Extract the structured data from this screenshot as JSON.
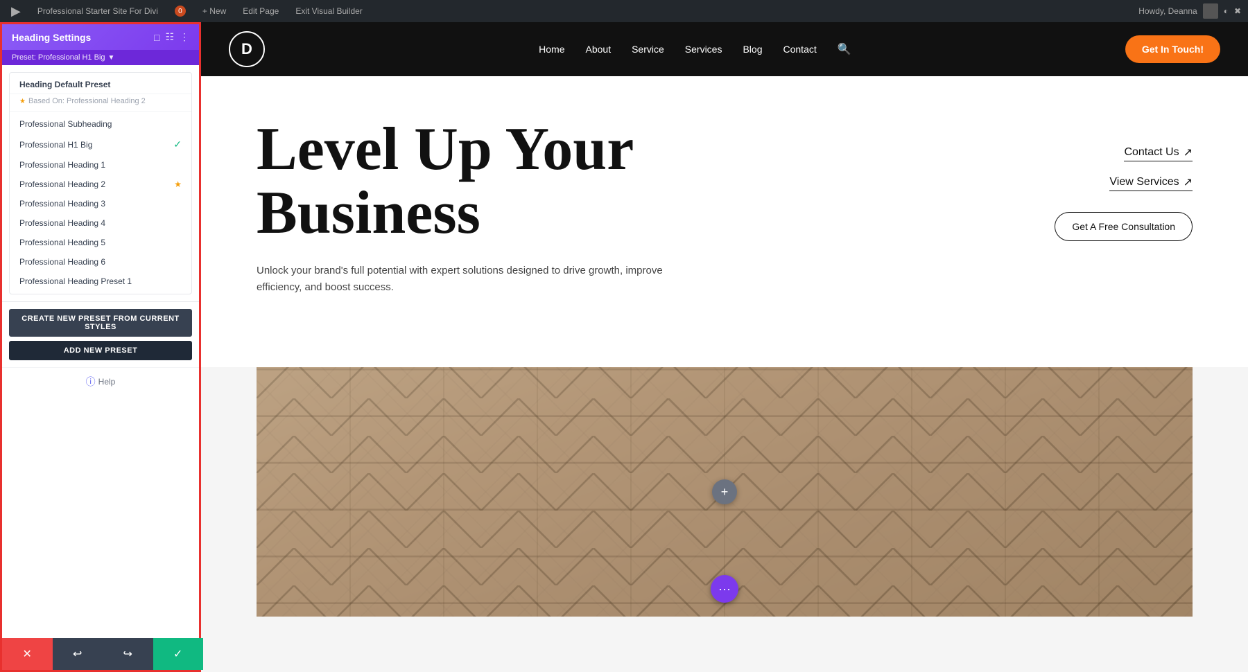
{
  "adminBar": {
    "wpLogoLabel": "W",
    "siteTitle": "Professional Starter Site For Divi",
    "commentCount": "0",
    "newLabel": "+ New",
    "editPageLabel": "Edit Page",
    "exitBuilderLabel": "Exit Visual Builder",
    "howdyText": "Howdy, Deanna"
  },
  "leftPanel": {
    "title": "Heading Settings",
    "presetLabel": "Preset: Professional H1 Big",
    "presetDropdown": {
      "sectionHeader": "Heading Default Preset",
      "basedOn": "Based On: Professional Heading 2",
      "items": [
        {
          "label": "Professional Subheading",
          "check": false,
          "star": false
        },
        {
          "label": "Professional H1 Big",
          "check": true,
          "star": false
        },
        {
          "label": "Professional Heading 1",
          "check": false,
          "star": false
        },
        {
          "label": "Professional Heading 2",
          "check": false,
          "star": true
        },
        {
          "label": "Professional Heading 3",
          "check": false,
          "star": false
        },
        {
          "label": "Professional Heading 4",
          "check": false,
          "star": false
        },
        {
          "label": "Professional Heading 5",
          "check": false,
          "star": false
        },
        {
          "label": "Professional Heading 6",
          "check": false,
          "star": false
        },
        {
          "label": "Professional Heading Preset 1",
          "check": false,
          "star": false
        }
      ]
    },
    "buttons": {
      "createPreset": "Create New Preset From Current Styles",
      "addPreset": "Add New Preset"
    },
    "helpLabel": "Help"
  },
  "toolbar": {
    "closeIcon": "✕",
    "undoIcon": "↩",
    "redoIcon": "↪",
    "saveIcon": "✓"
  },
  "siteHeader": {
    "logoLetter": "D",
    "navItems": [
      "Home",
      "About",
      "Service",
      "Services",
      "Blog",
      "Contact"
    ],
    "searchIcon": "🔍",
    "ctaButton": "Get In Touch!"
  },
  "hero": {
    "title": "Level Up Your Business",
    "description": "Unlock your brand's full potential with expert solutions designed to drive growth, improve efficiency, and boost success.",
    "links": [
      {
        "label": "Contact Us",
        "arrow": "↗"
      },
      {
        "label": "View Services",
        "arrow": "↗"
      }
    ],
    "consultationButton": "Get A Free Consultation"
  },
  "building": {
    "addButtonIcon": "+",
    "dotsButtonIcon": "•••"
  }
}
